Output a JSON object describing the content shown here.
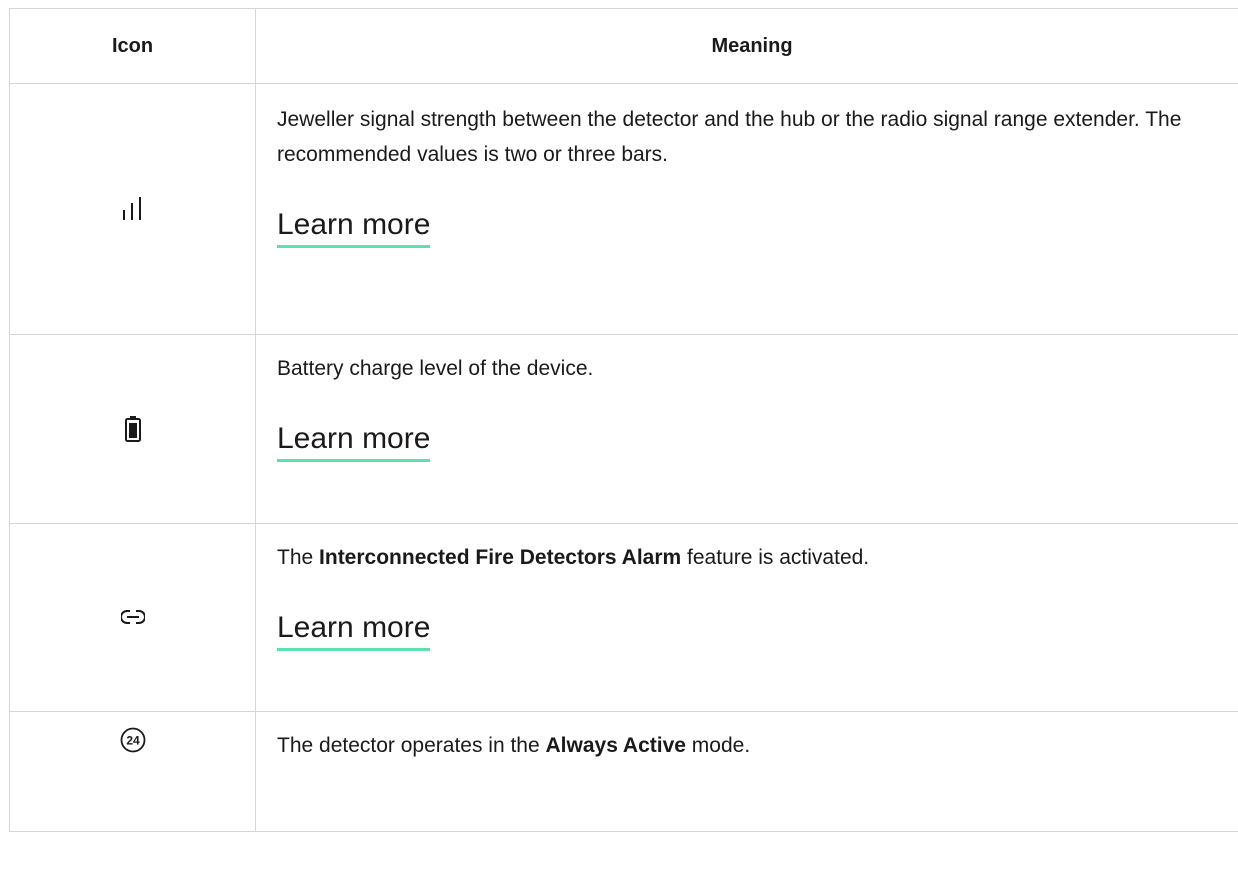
{
  "table": {
    "headers": {
      "icon": "Icon",
      "meaning": "Meaning"
    },
    "rows": [
      {
        "icon": "signal-strength-icon",
        "text": "Jeweller signal strength between the detector and the hub or the radio signal range extender. The recommended values is two or three bars.",
        "link": "Learn more"
      },
      {
        "icon": "battery-icon",
        "text": "Battery charge level of the device.",
        "link": "Learn more"
      },
      {
        "icon": "link-icon",
        "text_before": "The ",
        "text_bold": "Interconnected Fire Detectors Alarm",
        "text_after": " feature is activated.",
        "link": "Learn more"
      },
      {
        "icon": "always-active-24-icon",
        "icon_label": "24",
        "text_before": "The detector operates in the ",
        "text_bold": "Always Active",
        "text_after": " mode."
      }
    ]
  },
  "colors": {
    "link_underline": "#5ce0ac",
    "border": "#d6d6d6",
    "text": "#1a1a1a"
  }
}
